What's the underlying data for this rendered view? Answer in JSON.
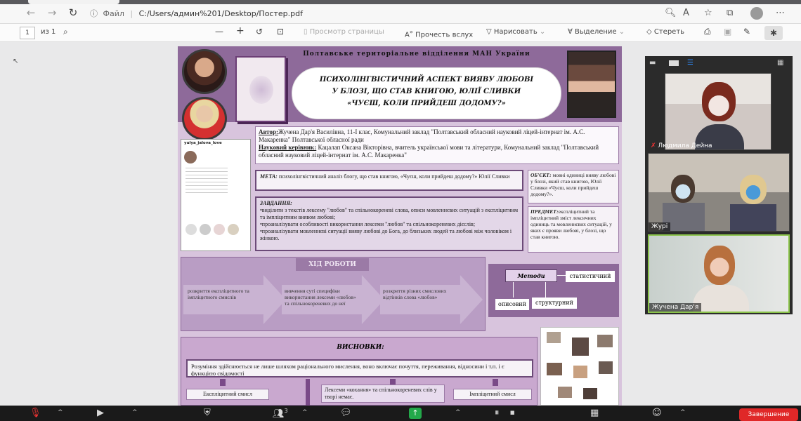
{
  "browser": {
    "back": "←",
    "forward": "→",
    "reload": "↻",
    "info": "ⓘ",
    "url_label": "Файл",
    "url": "C:/Users/админ%201/Desktop/Постер.pdf"
  },
  "pdf_toolbar": {
    "page": "1",
    "page_count": "из 1",
    "zoom_out": "—",
    "zoom_in": "+",
    "page_view": "Просмотр страницы",
    "read_aloud": "Прочесть вслух",
    "draw": "Нарисовать",
    "highlight": "Выделение",
    "erase": "Стереть"
  },
  "poster": {
    "org": "Полтавське територіальне відділення МАН України",
    "title_lines": [
      "ПСИХОЛІНГВІСТИЧНИЙ АСПЕКТ ВИЯВУ ЛЮБОВІ",
      "У БЛОЗІ, ЩО СТАВ КНИГОЮ, ЮЛІЇ СЛИВКИ",
      "«ЧУЄШ, КОЛИ ПРИЙДЕШ ДОДОМУ?»"
    ],
    "author_label": "Автор:",
    "author_text": "Жучена Дар'я Василівна, 11-І клас, Комунальний заклад \"Полтавський обласний науковий ліцей-інтернат ім. А.С. Макаренка\" Полтавської обласної ради",
    "supervisor_label": "Науковий керівник:",
    "supervisor_text": "Кацалап Оксана Вікторівна, вчитель української мови та літератури, Комунальний заклад \"Полтавський обласний науковий ліцей-інтернат ім. А.С. Макаренка\"",
    "insta_user": "yulya_jalova_love",
    "meta_label": "МЕТА:",
    "meta_text": "психолінгвістичний аналіз блогу, що став книгою, «Чуєш, коли прийдеш додому?» Юлії Сливки",
    "object_label": "ОБ'ЄКТ:",
    "object_text": "мовні одиниці вияву любові у блозі, який став книгою, Юлії Сливки «Чуєш, коли прийдеш додому?».",
    "tasks_label": "ЗАВДАННЯ:",
    "tasks": [
      "•виділити з текстів лексему \"любов\" та спільнокореневі слова, описи мовленнєвих ситуацій з експліцитним та імпліцитним виявом любові;",
      "•проаналізувати особливості використання лексеми \"любов\" та спільнокореневих дієслів;",
      "•проаналізувати мовленнєві ситуації вияву любові до Бога, до близьких людей та любові між чоловіком і жінкою."
    ],
    "subject_label": "ПРЕДМЕТ:",
    "subject_text": "експліцитний та імпліцитний зміст лексичних одиниць та мовленнєвих ситуацій, у яких є прояви любові, у блозі, що став книгою.",
    "progress_label": "ХІД РОБОТИ",
    "steps": [
      "розкриття експліцитного та імпліцитного смислів",
      "вивчення суті специфіки використання лексеми «любов» та спільнокореневих до неї",
      "розкриття різних смислових відтінків слова «любов»"
    ],
    "methods_label": "Методи",
    "method_stat": "статистичний",
    "method_desc": "описовий",
    "method_struct": "структурний",
    "conclusions_label": "ВИСНОВКИ:",
    "conclusion_main": "Розуміння здійснюється не лише шляхом раціонального мислення, воно включає почуття, переживання, відносини і т.п. і є функцією свідомості",
    "explicit": "Експліцитний смисл",
    "lexeme_text": "Лексеми «кохання» та спільнокореневих слів у творі немає.",
    "implicit": "Імпліцитний смисл"
  },
  "meeting": {
    "participants": [
      {
        "name": "Людмила Дейна"
      },
      {
        "name": "Журі"
      },
      {
        "name": "Жучена Дар'я"
      }
    ]
  },
  "zoom_bar": {
    "participants_count": "3",
    "end_label": "Завершение"
  }
}
